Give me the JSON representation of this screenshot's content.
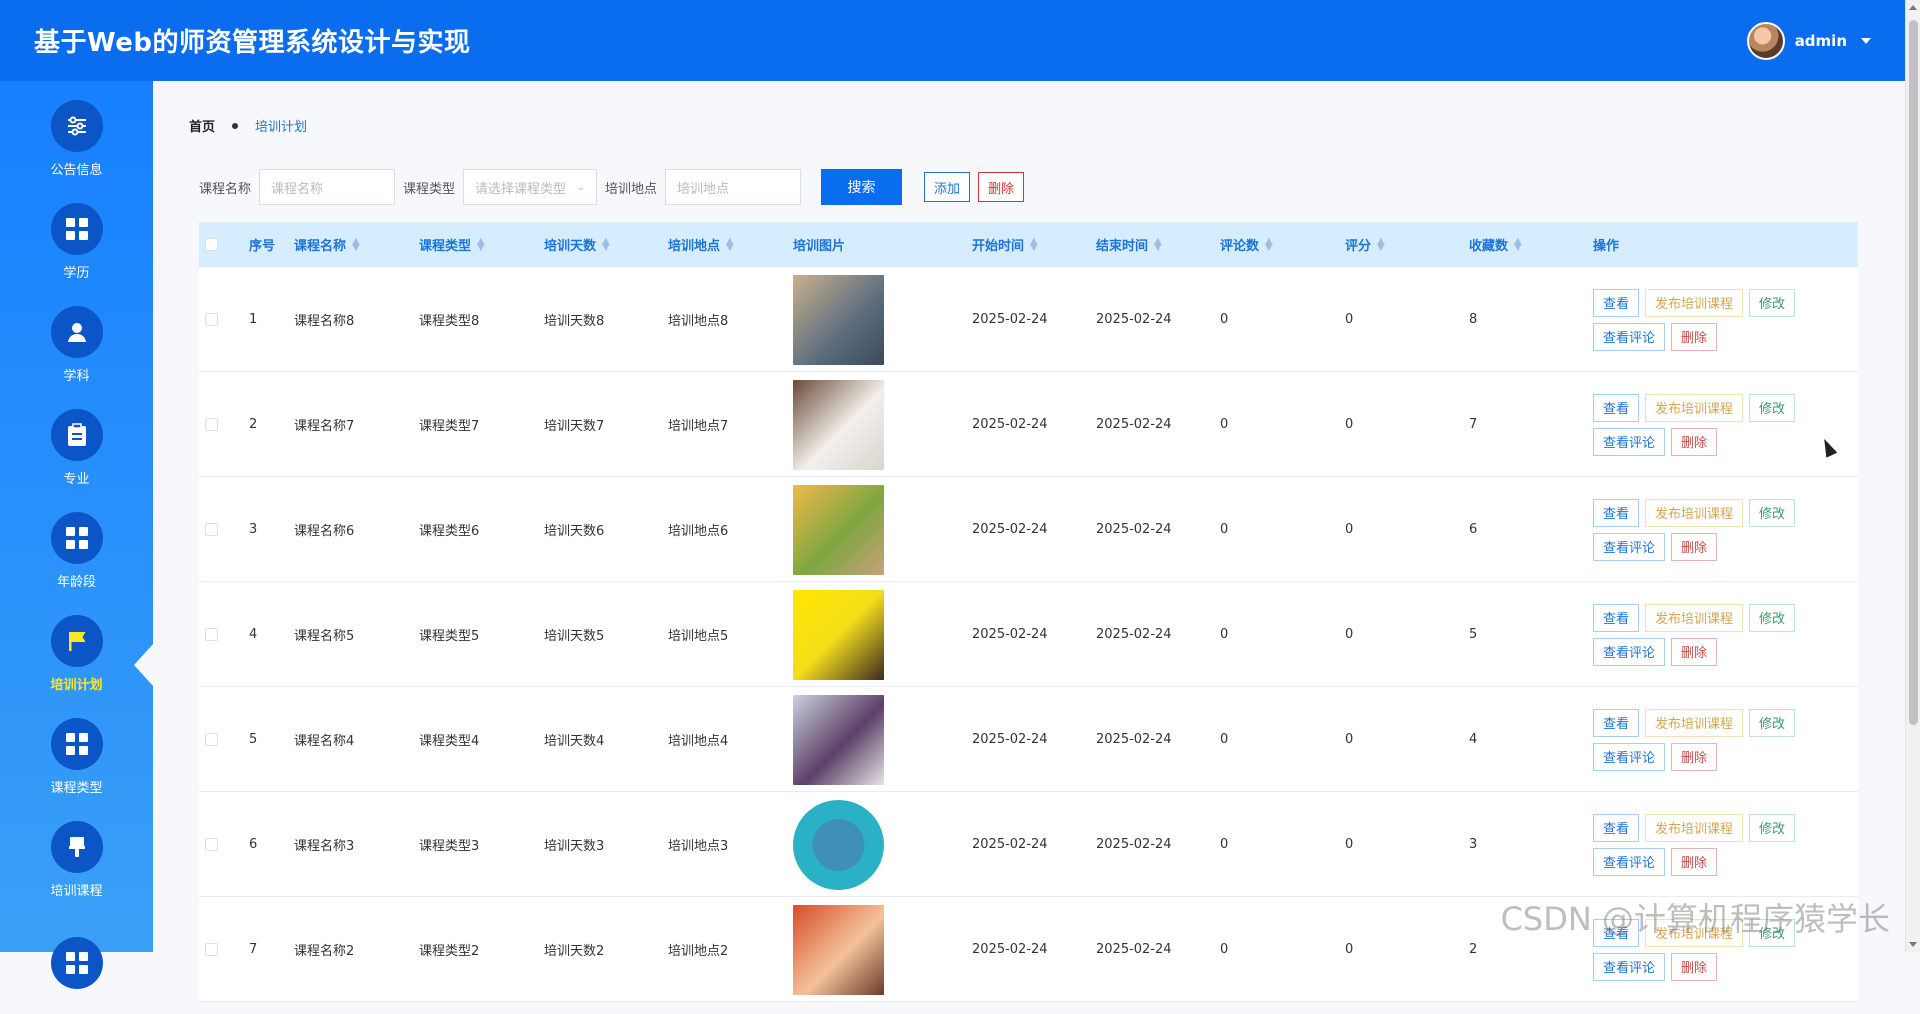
{
  "app": {
    "title": "基于Web的师资管理系统设计与实现"
  },
  "user": {
    "name": "admin"
  },
  "sidebar": {
    "items": [
      {
        "label": "公告信息",
        "icon": "sliders-icon"
      },
      {
        "label": "学历",
        "icon": "grid-icon"
      },
      {
        "label": "学科",
        "icon": "user-icon"
      },
      {
        "label": "专业",
        "icon": "clipboard-icon"
      },
      {
        "label": "年龄段",
        "icon": "grid-icon"
      },
      {
        "label": "培训计划",
        "icon": "flag-icon",
        "active": true
      },
      {
        "label": "课程类型",
        "icon": "grid-icon"
      },
      {
        "label": "培训课程",
        "icon": "brush-icon"
      },
      {
        "label": "",
        "icon": "grid-icon"
      }
    ]
  },
  "breadcrumb": {
    "home": "首页",
    "current": "培训计划"
  },
  "filters": {
    "course_name_label": "课程名称",
    "course_name_placeholder": "课程名称",
    "course_type_label": "课程类型",
    "course_type_placeholder": "请选择课程类型",
    "location_label": "培训地点",
    "location_placeholder": "培训地点",
    "search": "搜索",
    "add": "添加",
    "delete": "删除"
  },
  "table": {
    "headers": {
      "index": "序号",
      "course_name": "课程名称",
      "course_type": "课程类型",
      "days": "培训天数",
      "location": "培训地点",
      "image": "培训图片",
      "start": "开始时间",
      "end": "结束时间",
      "comments": "评论数",
      "rating": "评分",
      "favorites": "收藏数",
      "actions": "操作"
    },
    "actions": {
      "view": "查看",
      "publish": "发布培训课程",
      "edit": "修改",
      "comments": "查看评论",
      "delete": "删除"
    },
    "rows": [
      {
        "index": "1",
        "course_name": "课程名称8",
        "course_type": "课程类型8",
        "days": "培训天数8",
        "location": "培训地点8",
        "start": "2025-02-24",
        "end": "2025-02-24",
        "comments": "0",
        "rating": "0",
        "favorites": "8"
      },
      {
        "index": "2",
        "course_name": "课程名称7",
        "course_type": "课程类型7",
        "days": "培训天数7",
        "location": "培训地点7",
        "start": "2025-02-24",
        "end": "2025-02-24",
        "comments": "0",
        "rating": "0",
        "favorites": "7"
      },
      {
        "index": "3",
        "course_name": "课程名称6",
        "course_type": "课程类型6",
        "days": "培训天数6",
        "location": "培训地点6",
        "start": "2025-02-24",
        "end": "2025-02-24",
        "comments": "0",
        "rating": "0",
        "favorites": "6"
      },
      {
        "index": "4",
        "course_name": "课程名称5",
        "course_type": "课程类型5",
        "days": "培训天数5",
        "location": "培训地点5",
        "start": "2025-02-24",
        "end": "2025-02-24",
        "comments": "0",
        "rating": "0",
        "favorites": "5"
      },
      {
        "index": "5",
        "course_name": "课程名称4",
        "course_type": "课程类型4",
        "days": "培训天数4",
        "location": "培训地点4",
        "start": "2025-02-24",
        "end": "2025-02-24",
        "comments": "0",
        "rating": "0",
        "favorites": "4"
      },
      {
        "index": "6",
        "course_name": "课程名称3",
        "course_type": "课程类型3",
        "days": "培训天数3",
        "location": "培训地点3",
        "start": "2025-02-24",
        "end": "2025-02-24",
        "comments": "0",
        "rating": "0",
        "favorites": "3"
      },
      {
        "index": "7",
        "course_name": "课程名称2",
        "course_type": "课程类型2",
        "days": "培训天数2",
        "location": "培训地点2",
        "start": "2025-02-24",
        "end": "2025-02-24",
        "comments": "0",
        "rating": "0",
        "favorites": "2"
      }
    ]
  },
  "watermark": "CSDN @计算机程序猿学长"
}
